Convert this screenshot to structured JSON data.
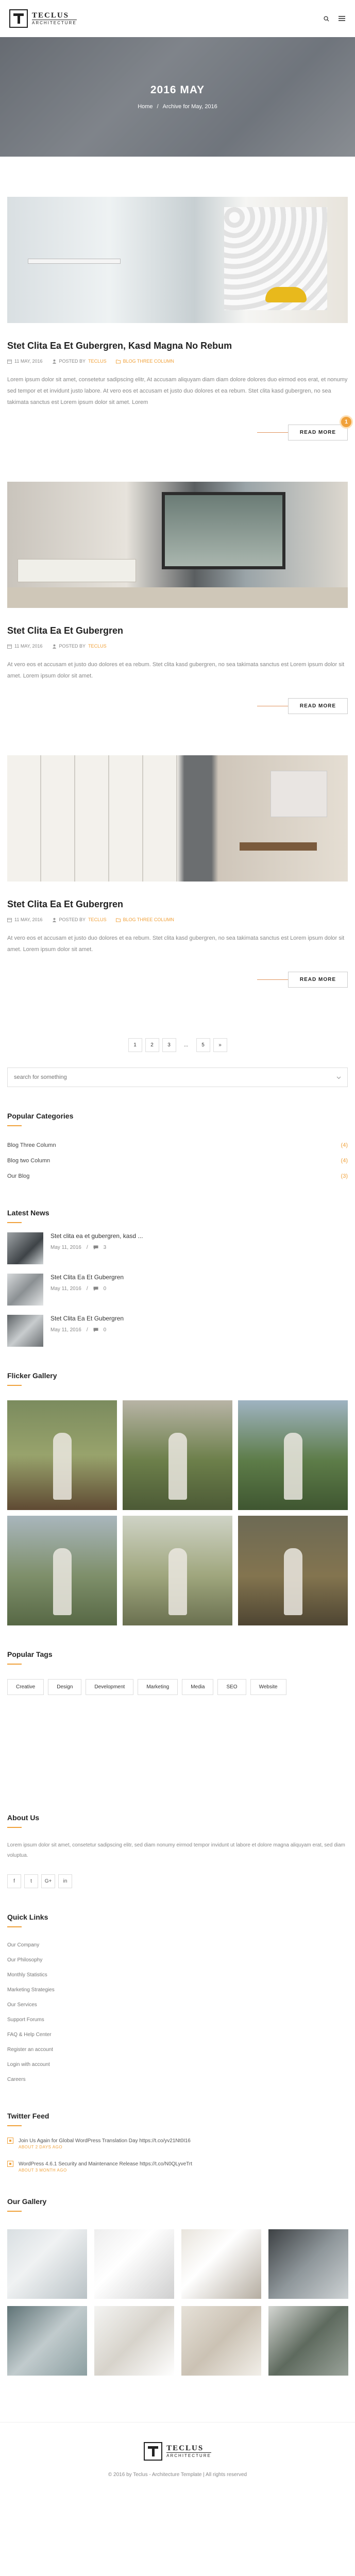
{
  "header": {
    "logo_name": "TECLUS",
    "logo_sub": "ARCHITECTURE"
  },
  "banner": {
    "title": "2016 MAY",
    "breadcrumb_home": "Home",
    "breadcrumb_sep": "/",
    "breadcrumb_current": "Archive for May, 2016"
  },
  "posts": [
    {
      "title": "Stet Clita Ea Et Gubergren, Kasd Magna No Rebum",
      "date": "11 MAY, 2016",
      "posted_by_label": "POSTED BY",
      "author": "TECLUS",
      "category": "BLOG THREE COLUMN",
      "excerpt": "Lorem ipsum dolor sit amet, consetetur sadipscing elitr, At accusam aliquyam diam diam dolore dolores duo eirmod eos erat, et nonumy sed tempor et et invidunt justo labore. At vero eos et accusam et justo duo dolores et ea rebum. Stet clita kasd gubergren, no sea takimata sanctus est Lorem ipsum dolor sit amet. Lorem",
      "read_more": "READ MORE",
      "badge": "1"
    },
    {
      "title": "Stet Clita Ea Et Gubergren",
      "date": "11 MAY, 2016",
      "posted_by_label": "POSTED BY",
      "author": "TECLUS",
      "category": "",
      "excerpt": "At vero eos et accusam et justo duo dolores et ea rebum. Stet clita kasd gubergren, no sea takimata sanctus est Lorem ipsum dolor sit amet. Lorem ipsum dolor sit amet.",
      "read_more": "READ MORE"
    },
    {
      "title": "Stet Clita Ea Et Gubergren",
      "date": "11 MAY, 2016",
      "posted_by_label": "POSTED BY",
      "author": "TECLUS",
      "category": "BLOG THREE COLUMN",
      "excerpt": "At vero eos et accusam et justo duo dolores et ea rebum. Stet clita kasd gubergren, no sea takimata sanctus est Lorem ipsum dolor sit amet. Lorem ipsum dolor sit amet.",
      "read_more": "READ MORE"
    }
  ],
  "pagination": {
    "pages": [
      "1",
      "2",
      "3",
      "...",
      "5",
      "»"
    ]
  },
  "search": {
    "placeholder": "search for something"
  },
  "popular_categories": {
    "title": "Popular Categories",
    "items": [
      {
        "label": "Blog Three Column",
        "count": "(4)"
      },
      {
        "label": "Blog two Column",
        "count": "(4)"
      },
      {
        "label": "Our Blog",
        "count": "(3)"
      }
    ]
  },
  "latest_news": {
    "title": "Latest News",
    "items": [
      {
        "title": "Stet clita ea et gubergren, kasd ...",
        "date": "May 11, 2016",
        "sep": "/",
        "comments": "3"
      },
      {
        "title": "Stet Clita Ea Et Gubergren",
        "date": "May 11, 2016",
        "sep": "/",
        "comments": "0"
      },
      {
        "title": "Stet Clita Ea Et Gubergren",
        "date": "May 11, 2016",
        "sep": "/",
        "comments": "0"
      }
    ]
  },
  "flickr": {
    "title": "Flicker Gallery"
  },
  "popular_tags": {
    "title": "Popular Tags",
    "tags": [
      "Creative",
      "Design",
      "Development",
      "Marketing",
      "Media",
      "SEO",
      "Website"
    ]
  },
  "about": {
    "title": "About Us",
    "text": "Lorem ipsum dolor sit amet, consetetur sadipscing elitr, sed diam nonumy eirmod tempor invidunt ut labore et dolore magna aliquyam erat, sed diam voluptua.",
    "social": [
      "f",
      "t",
      "G+",
      "in"
    ]
  },
  "quick_links": {
    "title": "Quick Links",
    "items": [
      "Our Company",
      "Our Philosophy",
      "Monthly Statistics",
      "Marketing Strategies",
      "Our Services",
      "Support Forums",
      "FAQ & Help Center",
      "Register an account",
      "Login with account",
      "Careers"
    ]
  },
  "twitter": {
    "title": "Twitter Feed",
    "items": [
      {
        "text": "Join Us Again for Global WordPress Translation Day https://t.co/yv21Nt0I16",
        "time": "ABOUT 2 DAYS AGO"
      },
      {
        "text": "WordPress 4.6.1 Security and Maintenance Release https://t.co/N0QLyveTrt",
        "time": "ABOUT 3 MONTH AGO"
      }
    ]
  },
  "our_gallery": {
    "title": "Our Gallery"
  },
  "footer": {
    "copyright": "© 2016 by Teclus - Architecture Template | All rights reserved"
  },
  "colors": {
    "accent": "#f0a13a",
    "text_muted": "#888888"
  }
}
